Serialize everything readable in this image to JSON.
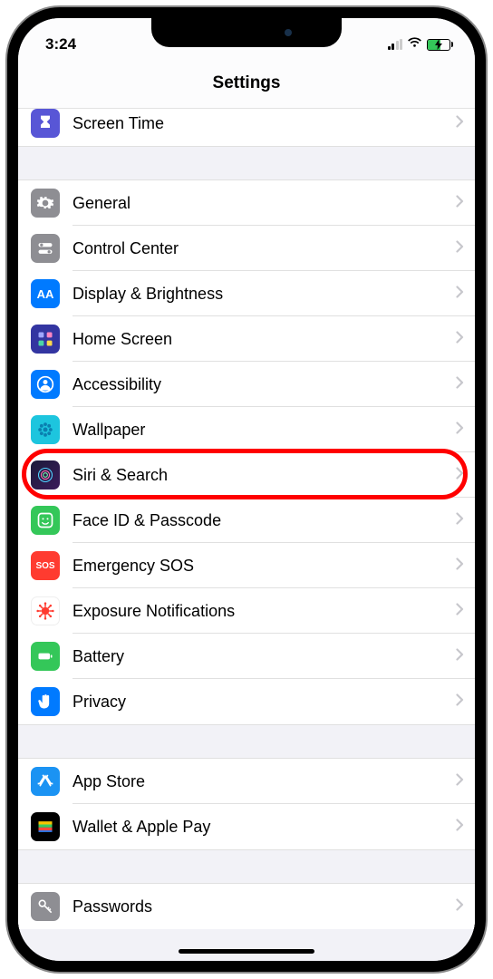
{
  "status": {
    "time": "3:24"
  },
  "header": {
    "title": "Settings"
  },
  "highlight": {
    "target_index": 7
  },
  "groups": [
    {
      "rows": [
        {
          "id": "screen-time",
          "label": "Screen Time",
          "icon": "hourglass-icon",
          "iconClass": "bg-screentime"
        }
      ]
    },
    {
      "rows": [
        {
          "id": "general",
          "label": "General",
          "icon": "gear-icon",
          "iconClass": "bg-general"
        },
        {
          "id": "control-center",
          "label": "Control Center",
          "icon": "switches-icon",
          "iconClass": "bg-cc"
        },
        {
          "id": "display-brightness",
          "label": "Display & Brightness",
          "icon": "text-size-icon",
          "iconClass": "bg-display",
          "iconText": "AA"
        },
        {
          "id": "home-screen",
          "label": "Home Screen",
          "icon": "grid-icon",
          "iconClass": "bg-home"
        },
        {
          "id": "accessibility",
          "label": "Accessibility",
          "icon": "person-circle-icon",
          "iconClass": "bg-access"
        },
        {
          "id": "wallpaper",
          "label": "Wallpaper",
          "icon": "flower-icon",
          "iconClass": "bg-wallpaper"
        },
        {
          "id": "siri-search",
          "label": "Siri & Search",
          "icon": "siri-icon",
          "iconClass": "bg-siri"
        },
        {
          "id": "faceid-passcode",
          "label": "Face ID & Passcode",
          "icon": "face-icon",
          "iconClass": "bg-faceid"
        },
        {
          "id": "emergency-sos",
          "label": "Emergency SOS",
          "icon": "sos-icon",
          "iconClass": "bg-sos",
          "iconText": "SOS"
        },
        {
          "id": "exposure-notifications",
          "label": "Exposure Notifications",
          "icon": "virus-icon",
          "iconClass": "bg-exposure"
        },
        {
          "id": "battery",
          "label": "Battery",
          "icon": "battery-icon",
          "iconClass": "bg-battery"
        },
        {
          "id": "privacy",
          "label": "Privacy",
          "icon": "hand-icon",
          "iconClass": "bg-privacy"
        }
      ]
    },
    {
      "rows": [
        {
          "id": "app-store",
          "label": "App Store",
          "icon": "appstore-icon",
          "iconClass": "bg-appstore"
        },
        {
          "id": "wallet-apple-pay",
          "label": "Wallet & Apple Pay",
          "icon": "wallet-icon",
          "iconClass": "bg-wallet"
        }
      ]
    },
    {
      "rows": [
        {
          "id": "passwords",
          "label": "Passwords",
          "icon": "key-icon",
          "iconClass": "bg-passwords"
        }
      ]
    }
  ]
}
